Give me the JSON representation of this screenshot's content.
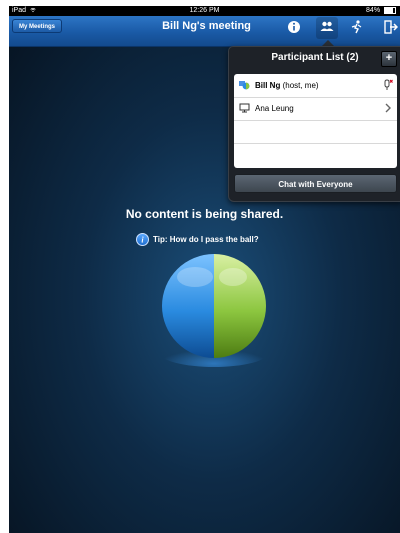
{
  "status_bar": {
    "device": "iPad",
    "time": "12:26 PM",
    "battery": "84%"
  },
  "nav_bar": {
    "my_meetings_label": "My Meetings",
    "title": "Bill Ng's meeting",
    "icons": [
      "info-icon",
      "participants-icon",
      "ball-pass-icon",
      "leave-icon"
    ]
  },
  "participants": {
    "header": "Participant List (2)",
    "add_label": "+",
    "items": [
      {
        "name": "Bill Ng",
        "role": "(host, me)",
        "icon": "host-presenter-icon",
        "right_icon": "mute-icon"
      },
      {
        "name": "Ana Leung",
        "role": "",
        "icon": "computer-icon",
        "right_icon": "chevron-right-icon"
      }
    ],
    "chat_label": "Chat with Everyone"
  },
  "main": {
    "no_content_text": "No content is being shared.",
    "tip_text": "Tip: How do I pass the ball?"
  },
  "colors": {
    "nav_blue": "#1a5aa6",
    "background_dark": "#0e2b47",
    "ball_blue": "#2a8be0",
    "ball_green": "#8cc63f"
  }
}
